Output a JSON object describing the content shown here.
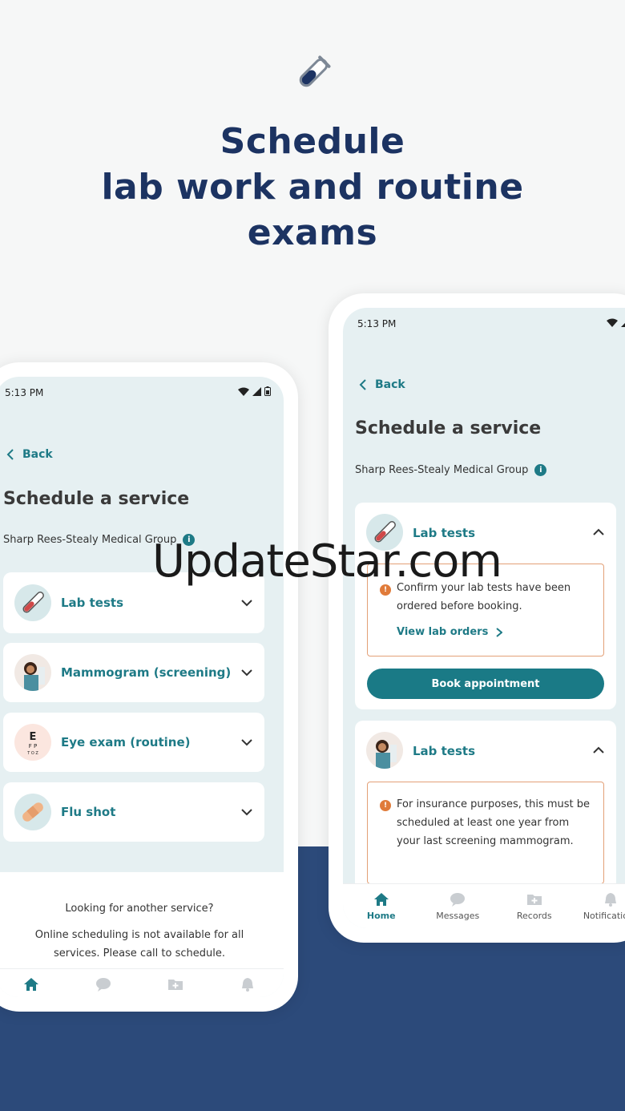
{
  "hero": {
    "icon": "test-tube-icon",
    "headline_line1": "Schedule",
    "headline_line2": "lab work and routine",
    "headline_line3": "exams"
  },
  "colors": {
    "navy": "#1c3362",
    "band": "#2c4a7a",
    "teal": "#1e7a86",
    "warning": "#e07b3a"
  },
  "left_phone": {
    "status_time": "5:13 PM",
    "back_label": "Back",
    "title": "Schedule a service",
    "provider": "Sharp Rees-Stealy Medical Group",
    "services": [
      {
        "label": "Lab tests",
        "icon": "test-tube-icon"
      },
      {
        "label": "Mammogram (screening)",
        "icon": "woman-avatar-icon"
      },
      {
        "label": "Eye exam (routine)",
        "icon": "eye-chart-icon"
      },
      {
        "label": "Flu shot",
        "icon": "bandage-icon"
      }
    ],
    "footer_heading": "Looking for another service?",
    "footer_text": "Online scheduling is not available for all services. Please call to schedule."
  },
  "right_phone": {
    "status_time": "5:13 PM",
    "back_label": "Back",
    "title": "Schedule a service",
    "provider": "Sharp Rees-Stealy Medical Group",
    "card1_label": "Lab tests",
    "card1_notice": "Confirm your lab tests have been ordered before booking.",
    "card1_link": "View lab orders",
    "book_button": "Book appointment",
    "card2_label": "Lab tests",
    "card2_notice": "For insurance purposes, this must be scheduled at least one year from your last screening mammogram."
  },
  "tabs": [
    {
      "label": "Home",
      "icon": "home-icon"
    },
    {
      "label": "Messages",
      "icon": "chat-icon"
    },
    {
      "label": "Records",
      "icon": "folder-plus-icon"
    },
    {
      "label": "Notifications",
      "icon": "bell-icon"
    }
  ],
  "watermark": "UpdateStar.com"
}
